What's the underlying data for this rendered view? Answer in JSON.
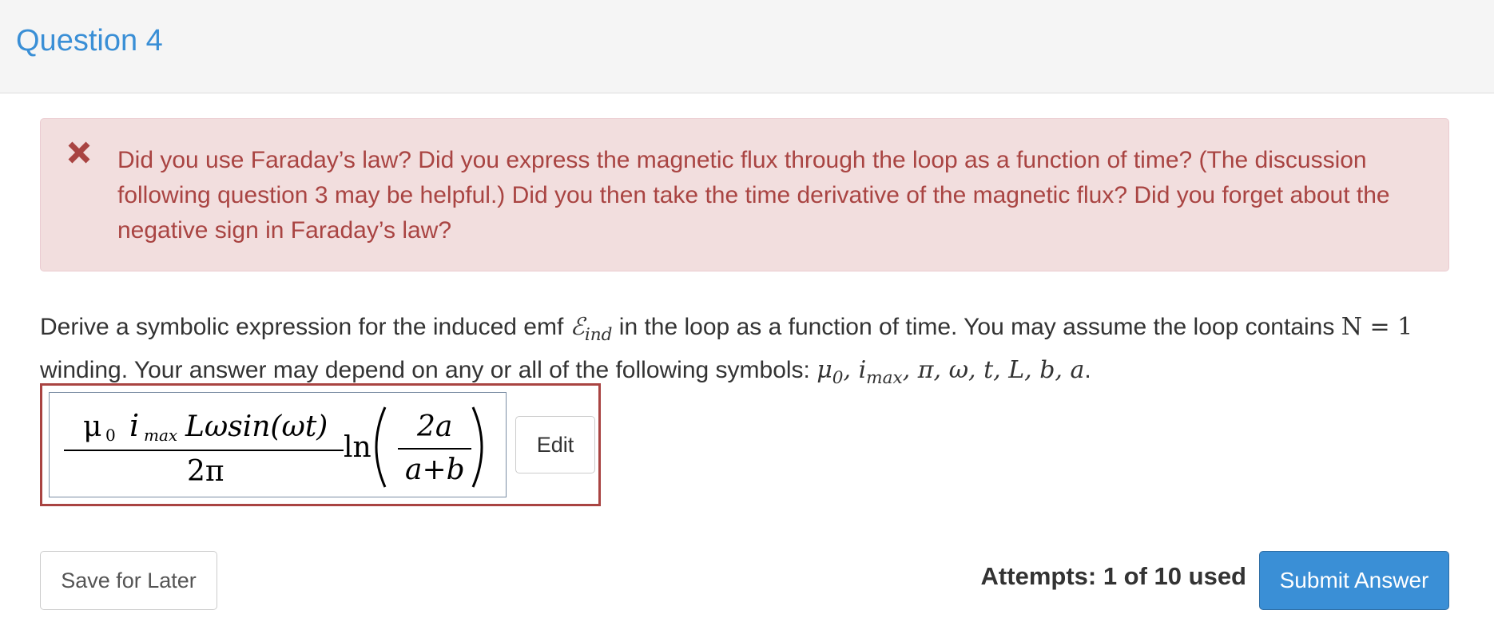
{
  "header": {
    "title": "Question 4"
  },
  "alert": {
    "icon": "close-icon",
    "message": "Did you use Faraday’s law? Did you express the magnetic flux through the loop as a function of time? (The discussion following question 3 may be helpful.) Did you then take the time derivative of the magnetic flux? Did you forget about the negative sign in Faraday’s law?"
  },
  "prompt": {
    "text_part1": "Derive a symbolic expression for the induced emf ",
    "emf_symbol": "ℰ",
    "emf_sub": "ind",
    "text_part2": " in the loop as a function of time. You may assume the loop contains ",
    "n_equation": "N = 1",
    "text_part3": " winding. Your answer may depend on any or all of the following symbols: ",
    "sym_mu": "μ",
    "sym_mu_sub": "0",
    "sym_sep1": ", ",
    "sym_i": "i",
    "sym_i_sub": "max",
    "sym_rest": ", π, ω, t, L, b, a",
    "text_end": "."
  },
  "answer": {
    "num_mu": "μ",
    "num_mu_sub": "0",
    "num_i": "i",
    "num_i_sub": "max",
    "num_rest": "Lωsin(ωt)",
    "den": "2π",
    "ln": "ln",
    "frac2_num": "2a",
    "frac2_den": "a+b"
  },
  "buttons": {
    "edit": "Edit",
    "save": "Save for Later",
    "submit": "Submit Answer"
  },
  "attempts": "Attempts: 1 of 10 used",
  "colors": {
    "accent": "#3a8fd6",
    "alert_bg": "#f2dede",
    "alert_text": "#a94442",
    "answer_border": "#a94442"
  }
}
